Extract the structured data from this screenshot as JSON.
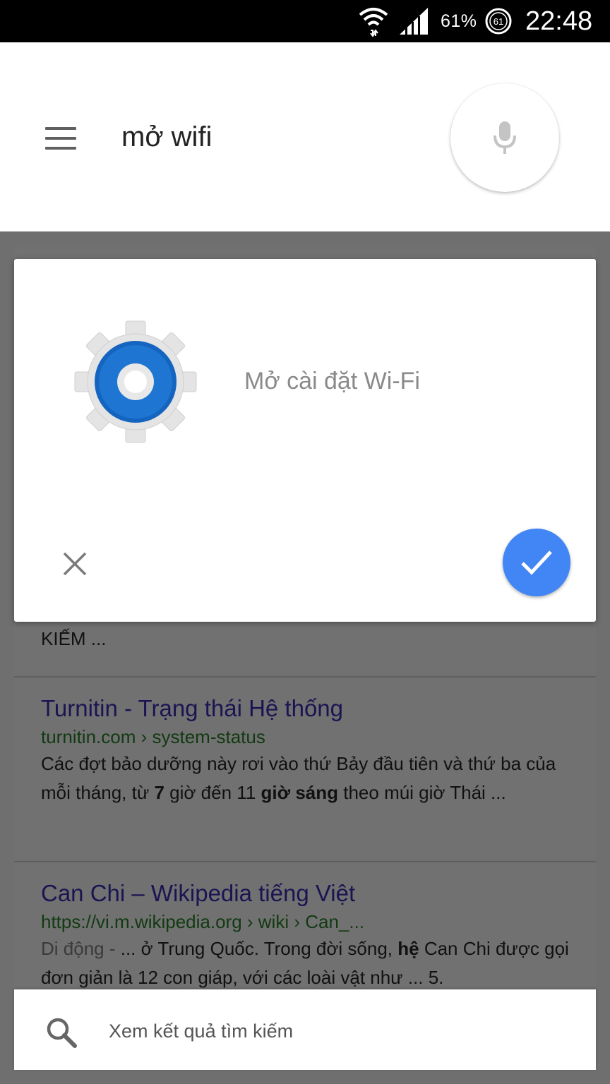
{
  "status_bar": {
    "battery": "61%",
    "battery_ring": "61",
    "time": "22:48",
    "icons": [
      "wifi-icon",
      "signal-icon",
      "battery-ring-icon"
    ]
  },
  "search": {
    "query": "mở wifi",
    "menu_icon": "hamburger-menu-icon",
    "mic_icon": "microphone-icon"
  },
  "dialog": {
    "app_icon": "settings-gear-icon",
    "label": "Mở cài đặt Wi-Fi",
    "dismiss_icon": "close-icon",
    "confirm_icon": "checkmark-icon",
    "accent": "#4285f4"
  },
  "results": {
    "partial_snippet": "KIẾM ...",
    "items": [
      {
        "title": "Turnitin - Trạng thái Hệ thống",
        "url": "turnitin.com › system-status",
        "snippet_parts": [
          "Các đợt bảo dưỡng này rơi vào thứ Bảy đầu tiên và thứ ba của mỗi tháng, từ ",
          "7",
          " giờ đến 11 ",
          "giờ sáng",
          " theo múi giờ Thái ..."
        ]
      },
      {
        "title": "Can Chi – Wikipedia tiếng Việt",
        "url": "https://vi.m.wikipedia.org › wiki › Can_...",
        "snippet_parts": [
          "Di động - ",
          "... ở Trung Quốc. Trong đời sống, ",
          "hệ",
          " Can Chi được gọi đơn giản là 12 con giáp, với các loài vật như ... 5."
        ]
      }
    ]
  },
  "bottom_bar": {
    "label": "Xem kết quả tìm kiếm",
    "icon": "search-icon"
  }
}
